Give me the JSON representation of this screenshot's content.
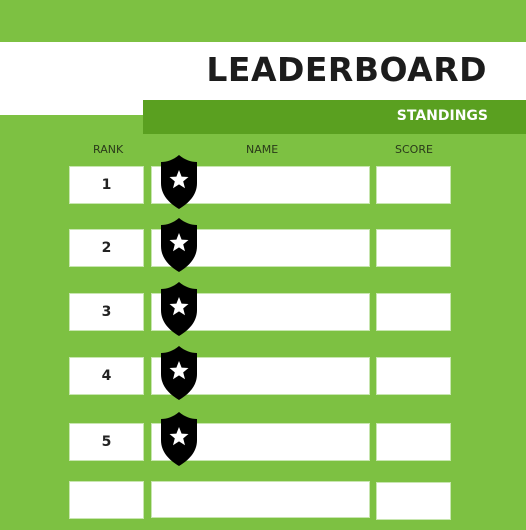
{
  "header": {
    "title": "LEADERBOARD",
    "subtitle": "STANDINGS"
  },
  "columns": {
    "rank": "RANK",
    "name": "NAME",
    "score": "SCORE"
  },
  "rows": [
    {
      "rank": "1",
      "name": "",
      "score": "",
      "badge": "shield-star-icon"
    },
    {
      "rank": "2",
      "name": "",
      "score": "",
      "badge": "shield-star-icon"
    },
    {
      "rank": "3",
      "name": "",
      "score": "",
      "badge": "shield-star-icon"
    },
    {
      "rank": "4",
      "name": "",
      "score": "",
      "badge": "shield-star-icon"
    },
    {
      "rank": "5",
      "name": "",
      "score": "",
      "badge": "shield-star-icon"
    },
    {
      "rank": "",
      "name": "",
      "score": ""
    }
  ],
  "colors": {
    "background": "#7dc142",
    "band": "#5aa020",
    "title": "#1c1c1c"
  }
}
